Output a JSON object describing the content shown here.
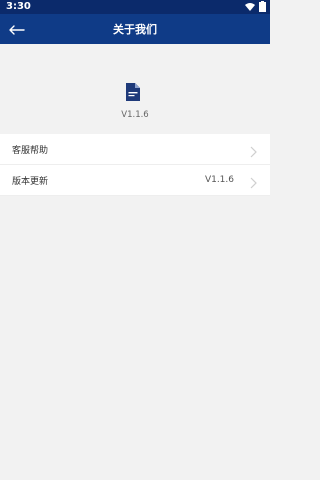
{
  "status": {
    "time": "3:30",
    "icons": [
      "wifi-icon",
      "battery-icon"
    ]
  },
  "header": {
    "title": "关于我们",
    "back_icon": "back-arrow-icon"
  },
  "about": {
    "logo_icon": "document-logo-icon",
    "version": "V1.1.6"
  },
  "list": {
    "items": [
      {
        "label": "客服帮助",
        "value": ""
      },
      {
        "label": "版本更新",
        "value": "V1.1.6"
      }
    ]
  },
  "colors": {
    "appbar": "#0f3b87",
    "statusbar": "#0b2a6b",
    "logo": "#1f3a7a",
    "background": "#f2f2f2"
  }
}
